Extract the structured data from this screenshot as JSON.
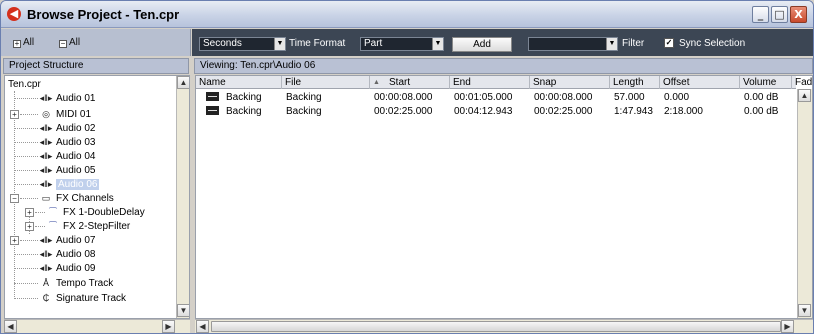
{
  "window": {
    "title": "Browse Project - Ten.cpr",
    "minimize": "_",
    "maximize": "□",
    "close": "X"
  },
  "left_toolbar": {
    "expand_all": "All",
    "collapse_all": "All"
  },
  "right_toolbar": {
    "time_format_value": "Seconds",
    "time_format_label": "Time Format",
    "part_value": "Part",
    "add_label": "Add",
    "filter_value": "",
    "filter_label": "Filter",
    "sync_label": "Sync Selection",
    "sync_checked": "✓"
  },
  "project_structure": {
    "header": "Project Structure",
    "root": "Ten.cpr",
    "items": [
      {
        "label": "Audio 01",
        "icon": "audio-track-icon"
      },
      {
        "label": "MIDI 01",
        "icon": "midi-track-icon"
      },
      {
        "label": "Audio 02",
        "icon": "audio-track-icon"
      },
      {
        "label": "Audio 03",
        "icon": "audio-track-icon"
      },
      {
        "label": "Audio 04",
        "icon": "audio-track-icon"
      },
      {
        "label": "Audio 05",
        "icon": "audio-track-icon"
      },
      {
        "label": "Audio 06",
        "icon": "audio-track-icon"
      },
      {
        "label": "FX Channels",
        "icon": "folder-icon"
      },
      {
        "label": "FX 1-DoubleDelay",
        "icon": "fx-channel-icon"
      },
      {
        "label": "FX 2-StepFilter",
        "icon": "fx-channel-icon"
      },
      {
        "label": "Audio 07",
        "icon": "audio-track-icon"
      },
      {
        "label": "Audio 08",
        "icon": "audio-track-icon"
      },
      {
        "label": "Audio 09",
        "icon": "audio-track-icon"
      },
      {
        "label": "Tempo Track",
        "icon": "tempo-track-icon"
      },
      {
        "label": "Signature Track",
        "icon": "signature-track-icon"
      }
    ],
    "selected": "Audio 06"
  },
  "viewing": "Viewing: Ten.cpr\\Audio 06",
  "table": {
    "columns": [
      "Name",
      "File",
      "Start",
      "End",
      "Snap",
      "Length",
      "Offset",
      "Volume",
      "Fad"
    ],
    "rows": [
      [
        "Backing",
        "Backing",
        "00:00:08.000",
        "00:01:05.000",
        "00:00:08.000",
        "57.000",
        "0.000",
        "0.00 dB"
      ],
      [
        "Backing",
        "Backing",
        "00:02:25.000",
        "00:04:12.943",
        "00:02:25.000",
        "1:47.943",
        "2:18.000",
        "0.00 dB"
      ]
    ]
  }
}
